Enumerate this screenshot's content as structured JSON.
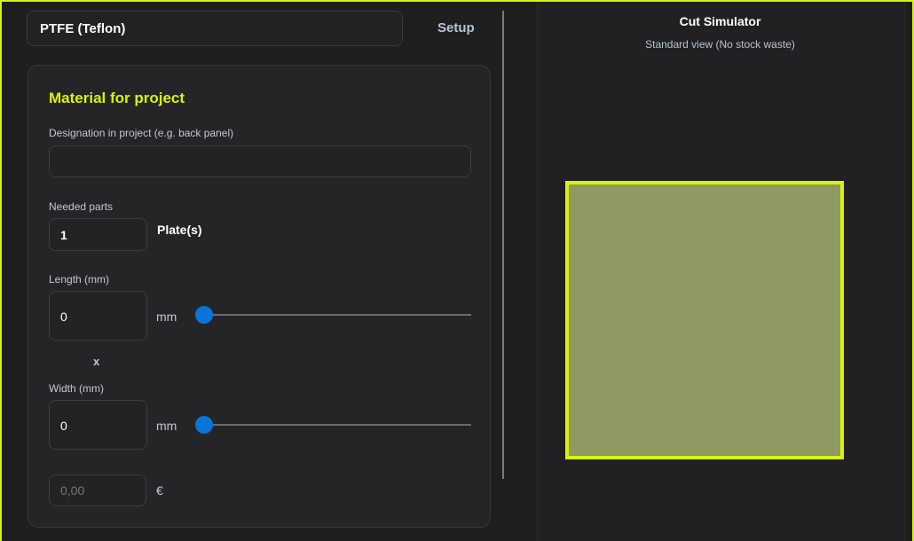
{
  "header": {
    "material_value": "PTFE (Teflon)",
    "setup_label": "Setup"
  },
  "card": {
    "title": "Material for project",
    "designation": {
      "label": "Designation in project (e.g. back panel)",
      "value": "",
      "placeholder": ""
    },
    "needed_parts": {
      "label": "Needed parts",
      "value": "1",
      "unit": "Plate(s)"
    },
    "length": {
      "label": "Length (mm)",
      "value": "0",
      "unit": "mm",
      "slider_fraction": 0
    },
    "multiply_symbol": "x",
    "width": {
      "label": "Width (mm)",
      "value": "0",
      "unit": "mm",
      "slider_fraction": 0
    },
    "price": {
      "placeholder": "0,00",
      "currency": "€"
    }
  },
  "simulator": {
    "title": "Cut Simulator",
    "subtitle": "Standard view (No stock waste)"
  },
  "colors": {
    "accent": "#d9f20a",
    "slider_thumb": "#0a74da",
    "plate_fill": "#8f9a63"
  }
}
